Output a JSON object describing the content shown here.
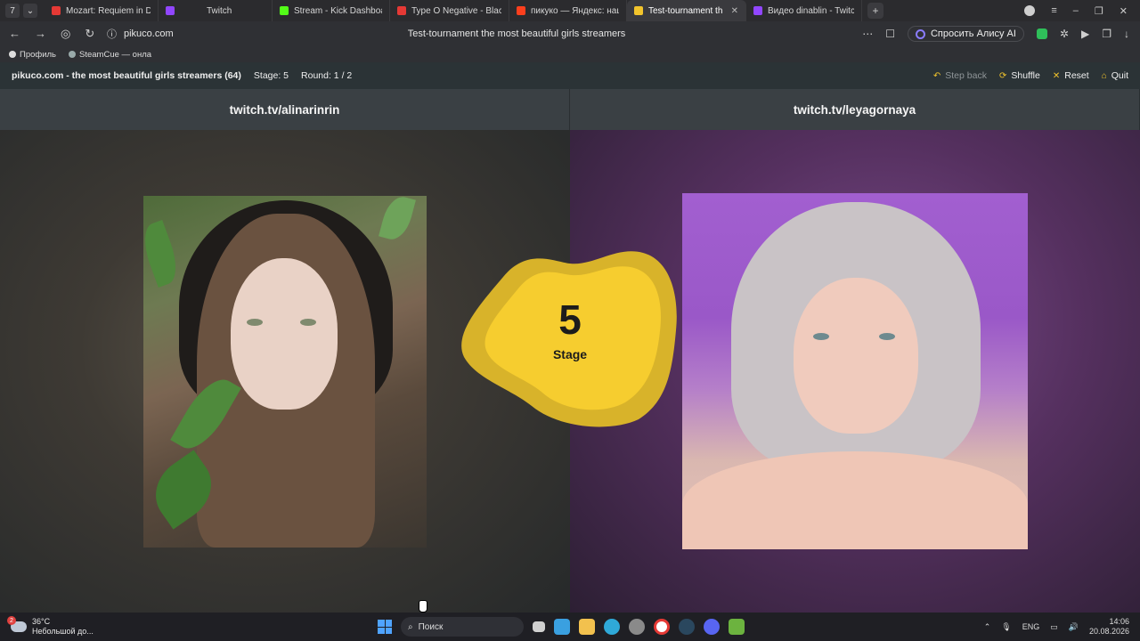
{
  "browser": {
    "tabs": [
      {
        "label": "Mozart: Requiem in D Mino",
        "color": "#e53935",
        "active": false
      },
      {
        "label": "Twitch",
        "color": "#9146ff",
        "active": false
      },
      {
        "label": "Stream - Kick Dashboard",
        "color": "#53fc18",
        "active": false
      },
      {
        "label": "Type O Negative - Black N",
        "color": "#e53935",
        "active": false
      },
      {
        "label": "пикуко — Яндекс: нашлос",
        "color": "#fc3f1d",
        "active": false
      },
      {
        "label": "Test-tournament the m",
        "color": "#f2c42c",
        "active": true
      },
      {
        "label": "Видео dinablin - Twitch",
        "color": "#9146ff",
        "active": false
      }
    ],
    "address": "pikuco.com",
    "page_title": "Test-tournament the most beautiful girls streamers",
    "alice_label": "Спросить Алису AI",
    "bookmarks": [
      "Профиль",
      "SteamCue — онла"
    ]
  },
  "site": {
    "title": "pikuco.com - the most beautiful girls streamers (64)",
    "stage_text": "Stage: 5",
    "round_text": "Round: 1 / 2",
    "actions": {
      "step_back": "Step back",
      "shuffle": "Shuffle",
      "reset": "Reset",
      "quit": "Quit"
    }
  },
  "contestants": {
    "left": {
      "name": "twitch.tv/alinarinrin"
    },
    "right": {
      "name": "twitch.tv/leyagornaya"
    }
  },
  "stage_badge": {
    "number": "5",
    "label": "Stage"
  },
  "taskbar": {
    "weather_temp": "36°C",
    "weather_desc": "Небольшой до...",
    "weather_badge": "2",
    "search_label": "Поиск",
    "lang": "ENG",
    "time": "14:06",
    "date": "20.08.2026"
  },
  "colors": {
    "accent": "#f2c42c",
    "header_bg": "#2b3336",
    "name_strip_bg": "#3a4044"
  }
}
